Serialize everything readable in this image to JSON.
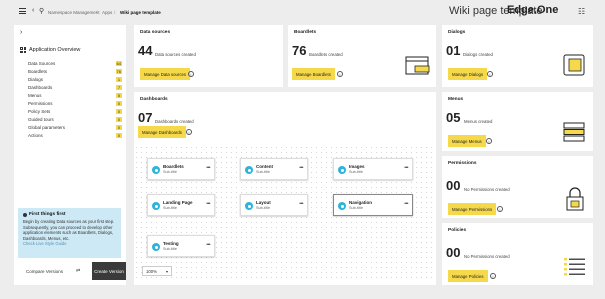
{
  "topbar": {
    "breadcrumbs": [
      "Namespace Management",
      "Apps",
      "Wiki page template"
    ],
    "title": "Wiki page template",
    "brand": "Edge.One"
  },
  "sidebar": {
    "header": "Application Overview",
    "items": [
      {
        "label": "Data Sources",
        "count": "64"
      },
      {
        "label": "Boardlets",
        "count": "76"
      },
      {
        "label": "Dialogs",
        "count": "1"
      },
      {
        "label": "Dashboards",
        "count": "7"
      },
      {
        "label": "Menus",
        "count": "5"
      },
      {
        "label": "Permissions",
        "count": "0"
      },
      {
        "label": "Policy Sets",
        "count": "0"
      },
      {
        "label": "Guided tours",
        "count": "0"
      },
      {
        "label": "Global parameters",
        "count": "0"
      },
      {
        "label": "Actions",
        "count": "0"
      }
    ],
    "info": {
      "title": "First things first",
      "body": "Begin by creating Data sources as your first step. Subsequently, you can proceed to develop other application elements such as Boardlets, Dialogs, Dashboards, Menus, etc.",
      "link": "Check Live Style Guide"
    },
    "compare_label": "Compare Versions",
    "create_label": "Create Version"
  },
  "cards": {
    "data_sources": {
      "title": "Data sources",
      "count": "44",
      "caption": "Data sources created",
      "button": "Manage Data sources"
    },
    "boardlets": {
      "title": "Boardlets",
      "count": "76",
      "caption": "Boardlets created",
      "button": "Manage Boardlets"
    },
    "dialogs": {
      "title": "Dialogs",
      "count": "01",
      "caption": "Dialogs created",
      "button": "Manage Dialogs"
    },
    "dashboards": {
      "title": "Dashboards",
      "count": "07",
      "caption": "Dashboards created",
      "button": "Manage Dashboards"
    },
    "menus": {
      "title": "Menus",
      "count": "05",
      "caption": "Menus created",
      "button": "Manage Menus"
    },
    "permissions": {
      "title": "Permissions",
      "count": "00",
      "caption": "No Permissions created",
      "button": "Manage Permissions"
    },
    "policies": {
      "title": "Policies",
      "count": "00",
      "caption": "No Permissions created",
      "button": "Manage Policies"
    }
  },
  "dashboard_nodes": [
    {
      "title": "Boardlets",
      "sub": "Sub-title"
    },
    {
      "title": "Content",
      "sub": "Sub-title"
    },
    {
      "title": "Images",
      "sub": "Sub-title"
    },
    {
      "title": "Landing Page",
      "sub": "Sub-title"
    },
    {
      "title": "Layout",
      "sub": "Sub-title"
    },
    {
      "title": "Navigation",
      "sub": "Sub-title"
    },
    {
      "title": "Testing",
      "sub": "Sub-title"
    }
  ],
  "zoom": "100%",
  "icons": {
    "menu": "hamburger-icon",
    "back": "chevron-left-icon",
    "location": "pin-icon",
    "settings": "sliders-icon",
    "collapse": "chevron-right-icon",
    "overview": "grid-icon",
    "info": "info-icon",
    "more": "more-horizontal-icon",
    "compare": "swap-icon"
  },
  "colors": {
    "accent": "#f5d94a",
    "node_dot": "#2fb3d9",
    "info_bg": "#cde9f5",
    "create_btn": "#3a3a3a"
  }
}
